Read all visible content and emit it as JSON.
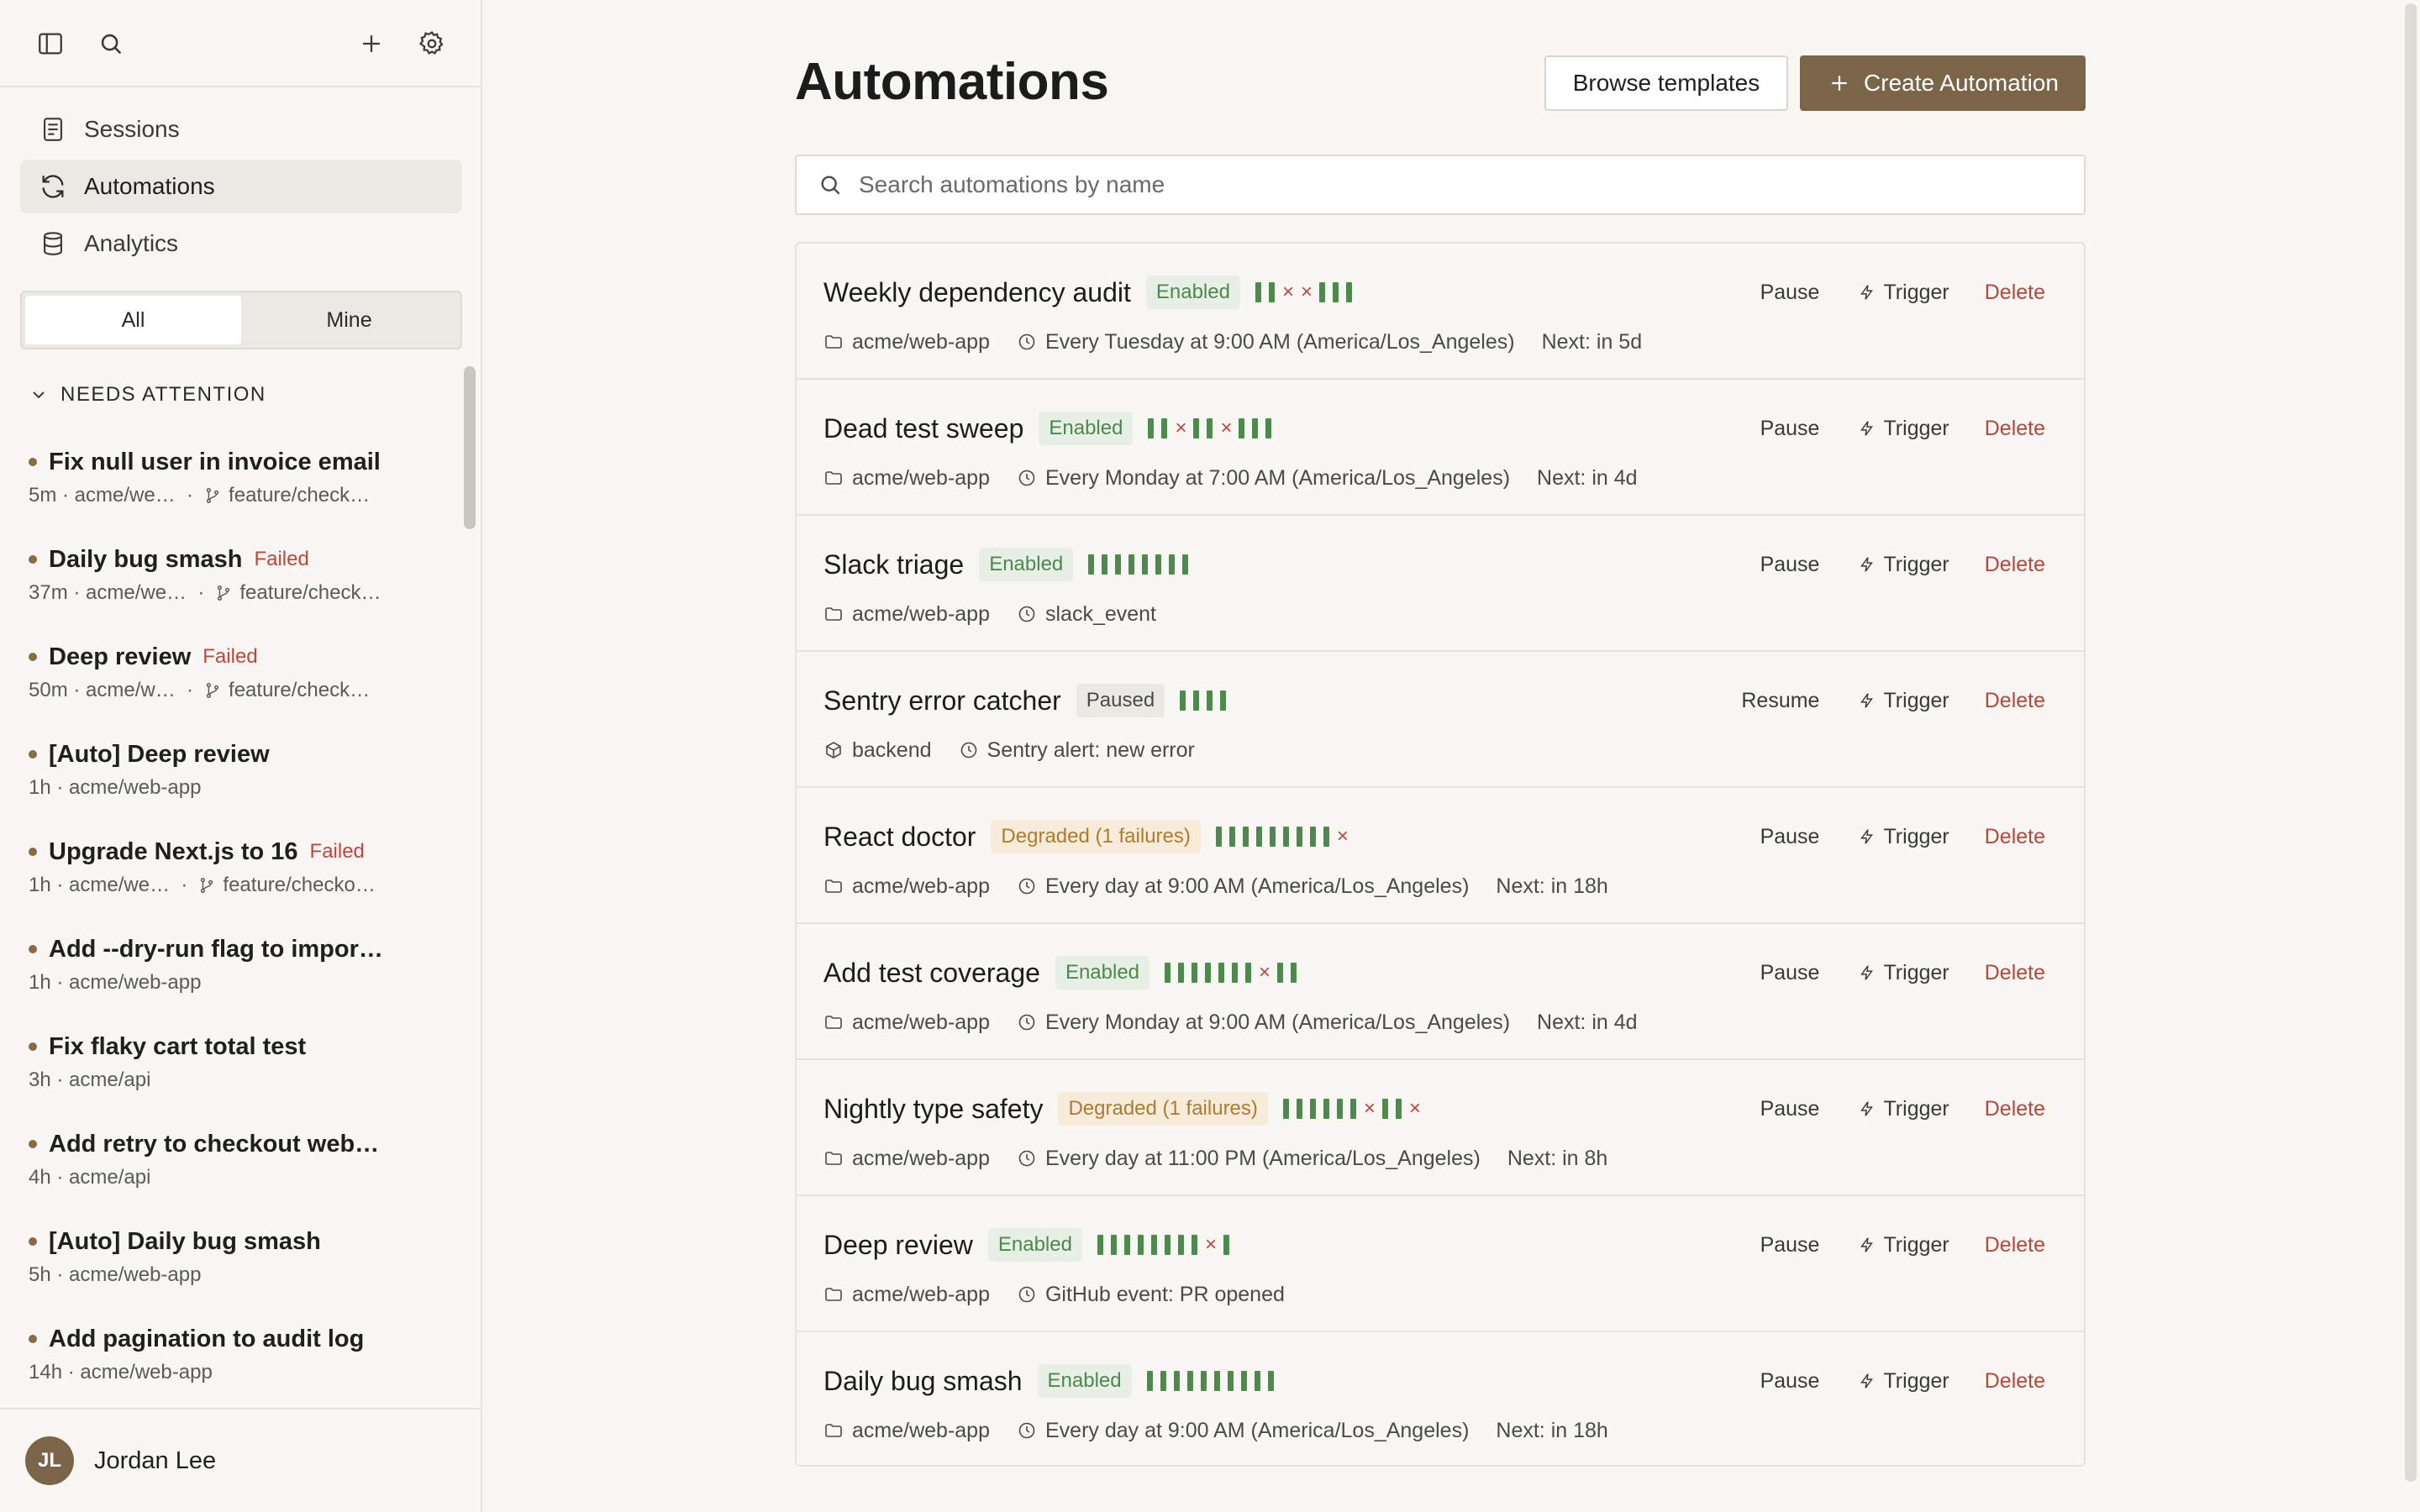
{
  "sidebar": {
    "nav": [
      {
        "label": "Sessions",
        "icon": "document-icon"
      },
      {
        "label": "Automations",
        "icon": "refresh-icon",
        "active": true
      },
      {
        "label": "Analytics",
        "icon": "database-icon"
      }
    ],
    "filter": {
      "all": "All",
      "mine": "Mine",
      "selected": "All"
    },
    "section_title": "NEEDS ATTENTION",
    "sessions": [
      {
        "title": "Fix null user in invoice email",
        "failed": "",
        "age": "5m",
        "repo": "acme/we…",
        "branch": "feature/check…"
      },
      {
        "title": "Daily bug smash",
        "failed": "Failed",
        "age": "37m",
        "repo": "acme/we…",
        "branch": "feature/check…"
      },
      {
        "title": "Deep review",
        "failed": "Failed",
        "age": "50m",
        "repo": "acme/w…",
        "branch": "feature/check…"
      },
      {
        "title": "[Auto] Deep review",
        "failed": "",
        "age": "1h",
        "repo": "acme/web-app",
        "branch": ""
      },
      {
        "title": "Upgrade Next.js to 16",
        "failed": "Failed",
        "age": "1h",
        "repo": "acme/we…",
        "branch": "feature/checko…"
      },
      {
        "title": "Add --dry-run flag to impor…",
        "failed": "",
        "age": "1h",
        "repo": "acme/web-app",
        "branch": ""
      },
      {
        "title": "Fix flaky cart total test",
        "failed": "",
        "age": "3h",
        "repo": "acme/api",
        "branch": ""
      },
      {
        "title": "Add retry to checkout web…",
        "failed": "",
        "age": "4h",
        "repo": "acme/api",
        "branch": ""
      },
      {
        "title": "[Auto] Daily bug smash",
        "failed": "",
        "age": "5h",
        "repo": "acme/web-app",
        "branch": ""
      },
      {
        "title": "Add pagination to audit log",
        "failed": "",
        "age": "14h",
        "repo": "acme/web-app",
        "branch": ""
      }
    ],
    "user": {
      "initials": "JL",
      "name": "Jordan Lee"
    }
  },
  "main": {
    "title": "Automations",
    "browse_label": "Browse templates",
    "create_label": "Create Automation",
    "search_placeholder": "Search automations by name",
    "actions": {
      "pause": "Pause",
      "resume": "Resume",
      "trigger": "Trigger",
      "delete": "Delete"
    },
    "automations": [
      {
        "name": "Weekly dependency audit",
        "status": "Enabled",
        "status_kind": "enabled",
        "runs": "ooxxooo",
        "repo_icon": "folder",
        "repo": "acme/web-app",
        "schedule": "Every Tuesday at 9:00 AM (America/Los_Angeles)",
        "next": "Next: in 5d",
        "action": "Pause"
      },
      {
        "name": "Dead test sweep",
        "status": "Enabled",
        "status_kind": "enabled",
        "runs": "ooxooxooo",
        "repo_icon": "folder",
        "repo": "acme/web-app",
        "schedule": "Every Monday at 7:00 AM (America/Los_Angeles)",
        "next": "Next: in 4d",
        "action": "Pause"
      },
      {
        "name": "Slack triage",
        "status": "Enabled",
        "status_kind": "enabled",
        "runs": "oooooooo",
        "repo_icon": "folder",
        "repo": "acme/web-app",
        "schedule": "slack_event",
        "next": "",
        "action": "Pause"
      },
      {
        "name": "Sentry error catcher",
        "status": "Paused",
        "status_kind": "paused",
        "runs": "oooo",
        "repo_icon": "package",
        "repo": "backend",
        "schedule": "Sentry alert: new error",
        "next": "",
        "action": "Resume"
      },
      {
        "name": "React doctor",
        "status": "Degraded (1 failures)",
        "status_kind": "degraded",
        "runs": "ooooooooox",
        "repo_icon": "folder",
        "repo": "acme/web-app",
        "schedule": "Every day at 9:00 AM (America/Los_Angeles)",
        "next": "Next: in 18h",
        "action": "Pause"
      },
      {
        "name": "Add test coverage",
        "status": "Enabled",
        "status_kind": "enabled",
        "runs": "oooooooxoo",
        "repo_icon": "folder",
        "repo": "acme/web-app",
        "schedule": "Every Monday at 9:00 AM (America/Los_Angeles)",
        "next": "Next: in 4d",
        "action": "Pause"
      },
      {
        "name": "Nightly type safety",
        "status": "Degraded (1 failures)",
        "status_kind": "degraded",
        "runs": "ooooooxoox",
        "repo_icon": "folder",
        "repo": "acme/web-app",
        "schedule": "Every day at 11:00 PM (America/Los_Angeles)",
        "next": "Next: in 8h",
        "action": "Pause"
      },
      {
        "name": "Deep review",
        "status": "Enabled",
        "status_kind": "enabled",
        "runs": "ooooooooxo",
        "repo_icon": "folder",
        "repo": "acme/web-app",
        "schedule": "GitHub event: PR opened",
        "next": "",
        "action": "Pause"
      },
      {
        "name": "Daily bug smash",
        "status": "Enabled",
        "status_kind": "enabled",
        "runs": "oooooooooo",
        "repo_icon": "folder",
        "repo": "acme/web-app",
        "schedule": "Every day at 9:00 AM (America/Los_Angeles)",
        "next": "Next: in 18h",
        "action": "Pause"
      }
    ]
  },
  "colors": {
    "accent": "#7a6548",
    "ok": "#4e8a4e",
    "fail": "#c0463b",
    "degraded": "#b07a30"
  }
}
